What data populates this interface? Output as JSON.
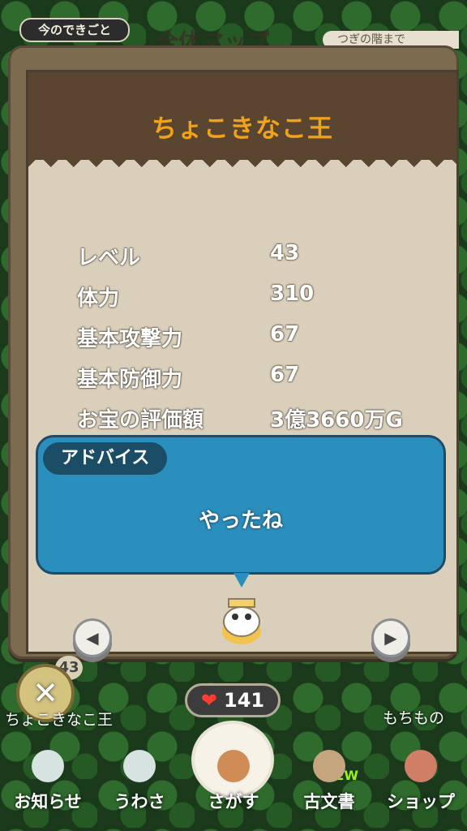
{
  "background": {
    "top_tag": "今のできごと",
    "top_title": "全体マップ",
    "top_right": "つぎの階まで"
  },
  "modal": {
    "title": "ちょこきなこ王",
    "stats": [
      {
        "label": "レベル",
        "value": "43"
      },
      {
        "label": "体力",
        "value": "310"
      },
      {
        "label": "基本攻撃力",
        "value": "67"
      },
      {
        "label": "基本防御力",
        "value": "67"
      },
      {
        "label": "お宝の評価額",
        "value": "3億3660万G"
      }
    ],
    "advice": {
      "tag": "アドバイス",
      "text": "やったね"
    },
    "nav": {
      "left_icon": "triangle-left-icon",
      "right_icon": "triangle-right-icon"
    }
  },
  "hud": {
    "level_bubble": "43",
    "close_icon": "close-x-icon",
    "name_tag": "ちょこきなこ王",
    "hp_value": "141",
    "mochimono": "もちもの"
  },
  "nav": {
    "items": [
      {
        "label": "お知らせ",
        "icon": "notice-icon"
      },
      {
        "label": "うわさ",
        "icon": "chat-icon"
      },
      {
        "label": "さがす",
        "icon": "treasure-search-icon"
      },
      {
        "label": "古文書",
        "icon": "scroll-icon"
      },
      {
        "label": "ショップ",
        "icon": "shop-icon"
      }
    ],
    "new_badge": "NEW"
  },
  "colors": {
    "title_orange": "#f0a21b",
    "advice_blue": "#2b8fbe",
    "modal_brown": "#7c6b4f",
    "paper": "#d9cfbb"
  }
}
